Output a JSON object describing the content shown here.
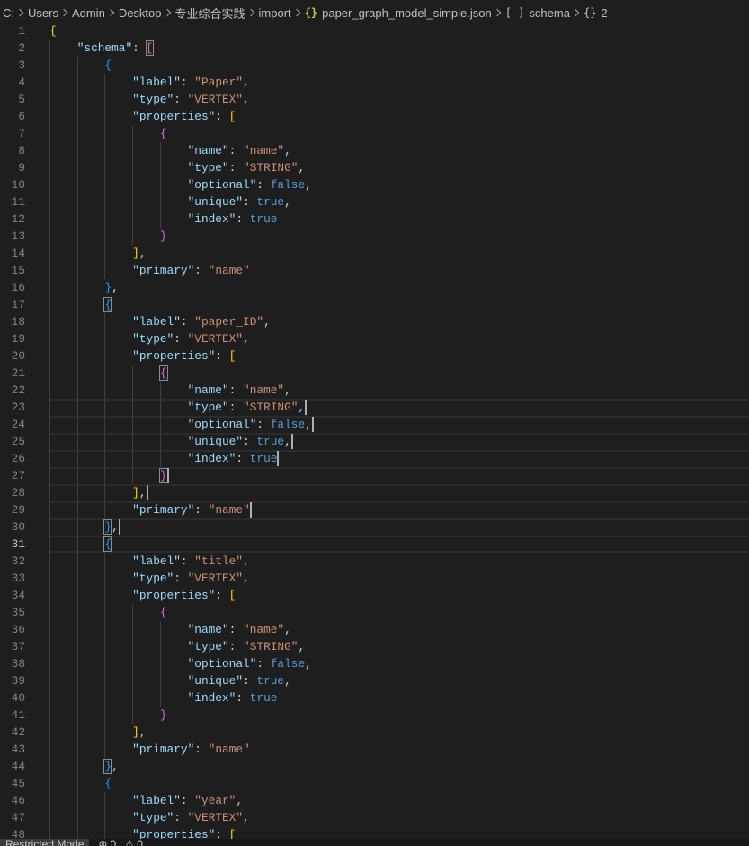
{
  "breadcrumbs": {
    "path": [
      "C:",
      "Users",
      "Admin",
      "Desktop",
      "专业综合实践",
      "import"
    ],
    "separator_icon": "chevron-right-icon",
    "file": {
      "icon": "json-file-icon",
      "name": "paper_graph_model_simple.json"
    },
    "symbols": [
      {
        "icon": "symbol-array-icon",
        "name": "schema"
      },
      {
        "icon": "symbol-object-icon",
        "name": "2"
      }
    ]
  },
  "editor": {
    "lines": [
      {
        "n": 1,
        "text": "{"
      },
      {
        "n": 2,
        "text": "    \"schema\": ["
      },
      {
        "n": 3,
        "text": "        {"
      },
      {
        "n": 4,
        "text": "            \"label\": \"Paper\","
      },
      {
        "n": 5,
        "text": "            \"type\": \"VERTEX\","
      },
      {
        "n": 6,
        "text": "            \"properties\": ["
      },
      {
        "n": 7,
        "text": "                {"
      },
      {
        "n": 8,
        "text": "                    \"name\": \"name\","
      },
      {
        "n": 9,
        "text": "                    \"type\": \"STRING\","
      },
      {
        "n": 10,
        "text": "                    \"optional\": false,"
      },
      {
        "n": 11,
        "text": "                    \"unique\": true,"
      },
      {
        "n": 12,
        "text": "                    \"index\": true"
      },
      {
        "n": 13,
        "text": "                }"
      },
      {
        "n": 14,
        "text": "            ],"
      },
      {
        "n": 15,
        "text": "            \"primary\": \"name\""
      },
      {
        "n": 16,
        "text": "        },"
      },
      {
        "n": 17,
        "text": "        {"
      },
      {
        "n": 18,
        "text": "            \"label\": \"paper_ID\","
      },
      {
        "n": 19,
        "text": "            \"type\": \"VERTEX\","
      },
      {
        "n": 20,
        "text": "            \"properties\": ["
      },
      {
        "n": 21,
        "text": "                {"
      },
      {
        "n": 22,
        "text": "                    \"name\": \"name\","
      },
      {
        "n": 23,
        "text": "                    \"type\": \"STRING\","
      },
      {
        "n": 24,
        "text": "                    \"optional\": false,"
      },
      {
        "n": 25,
        "text": "                    \"unique\": true,"
      },
      {
        "n": 26,
        "text": "                    \"index\": true"
      },
      {
        "n": 27,
        "text": "                }"
      },
      {
        "n": 28,
        "text": "            ],"
      },
      {
        "n": 29,
        "text": "            \"primary\": \"name\""
      },
      {
        "n": 30,
        "text": "        },"
      },
      {
        "n": 31,
        "text": "        {"
      },
      {
        "n": 32,
        "text": "            \"label\": \"title\","
      },
      {
        "n": 33,
        "text": "            \"type\": \"VERTEX\","
      },
      {
        "n": 34,
        "text": "            \"properties\": ["
      },
      {
        "n": 35,
        "text": "                {"
      },
      {
        "n": 36,
        "text": "                    \"name\": \"name\","
      },
      {
        "n": 37,
        "text": "                    \"type\": \"STRING\","
      },
      {
        "n": 38,
        "text": "                    \"optional\": false,"
      },
      {
        "n": 39,
        "text": "                    \"unique\": true,"
      },
      {
        "n": 40,
        "text": "                    \"index\": true"
      },
      {
        "n": 41,
        "text": "                }"
      },
      {
        "n": 42,
        "text": "            ],"
      },
      {
        "n": 43,
        "text": "            \"primary\": \"name\""
      },
      {
        "n": 44,
        "text": "        },"
      },
      {
        "n": 45,
        "text": "        {"
      },
      {
        "n": 46,
        "text": "            \"label\": \"year\","
      },
      {
        "n": 47,
        "text": "            \"type\": \"VERTEX\","
      },
      {
        "n": 48,
        "text": "            \"properties\": ["
      }
    ]
  },
  "status_bar": {
    "restricted_mode": "Restricted Mode",
    "errors": {
      "icon": "error-icon",
      "count": "0"
    },
    "warnings": {
      "icon": "warning-icon",
      "count": "0"
    }
  },
  "theme": {
    "editor_background": "#1e1e1e",
    "key": "#9cdcfe",
    "string": "#ce9178",
    "boolean": "#569cd6",
    "punctuation": "#d4d4d4",
    "bracket_colors": [
      "#ffd700",
      "#da70d6",
      "#179fff"
    ],
    "json_icon": "#cbcb41",
    "line_number": "#858585",
    "line_number_active": "#c6c6c6"
  }
}
